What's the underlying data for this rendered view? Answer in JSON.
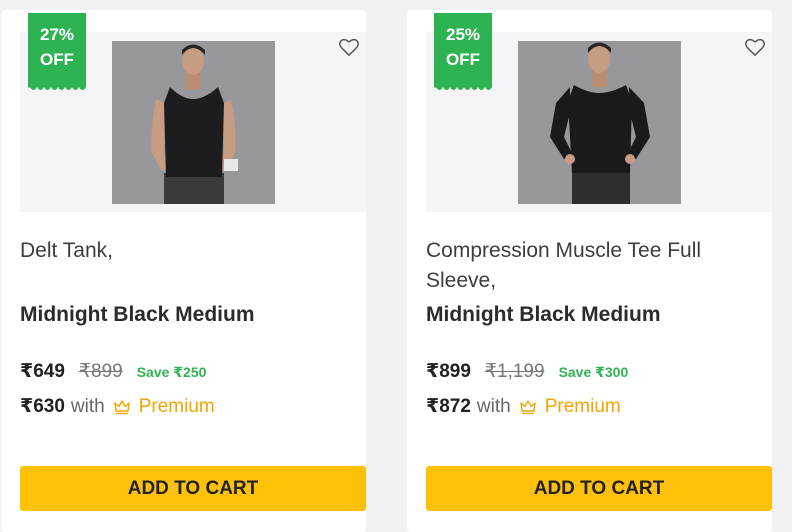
{
  "products": [
    {
      "discount_percent": "27%",
      "discount_off": "OFF",
      "name": "Delt Tank,",
      "variant": "Midnight Black Medium",
      "price": "₹649",
      "mrp": "₹899",
      "save": "Save ₹250",
      "premium_price": "₹630",
      "with_label": "with",
      "premium_label": "Premium",
      "cart_label": "ADD TO CART"
    },
    {
      "discount_percent": "25%",
      "discount_off": "OFF",
      "name": "Compression Muscle Tee Full Sleeve,",
      "variant": "Midnight Black Medium",
      "price": "₹899",
      "mrp": "₹1,199",
      "save": "Save ₹300",
      "premium_price": "₹872",
      "with_label": "with",
      "premium_label": "Premium",
      "cart_label": "ADD TO CART"
    }
  ],
  "icons": {
    "wishlist": "heart-icon",
    "premium": "crown-icon"
  },
  "colors": {
    "badge": "#2eb352",
    "save": "#2eb352",
    "premium": "#f0a500",
    "cart_button": "#ffc107"
  }
}
